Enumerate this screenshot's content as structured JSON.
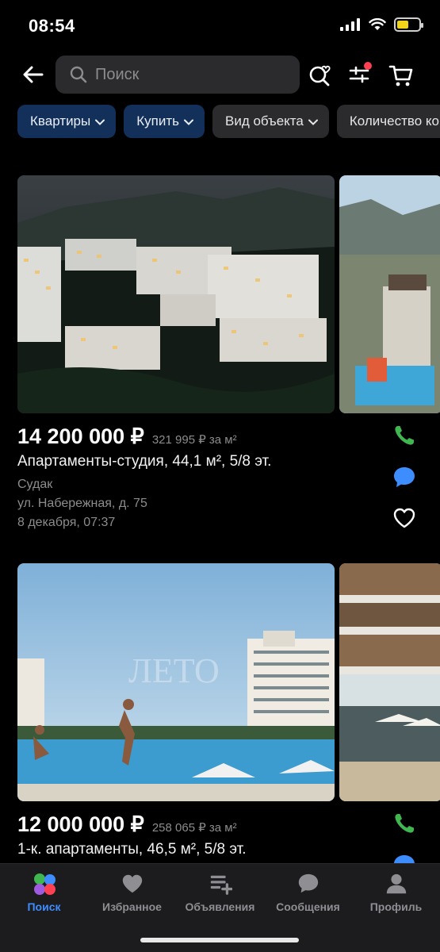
{
  "status": {
    "time": "08:54",
    "battery_level": 0.55
  },
  "search": {
    "placeholder": "Поиск"
  },
  "filters": [
    {
      "label": "Квартиры",
      "style": "blue"
    },
    {
      "label": "Купить",
      "style": "blue"
    },
    {
      "label": "Вид объекта",
      "style": "gray"
    },
    {
      "label": "Количество ко",
      "style": "gray"
    }
  ],
  "listings": [
    {
      "price": "14 200 000 ₽",
      "price_per_m2": "321 995 ₽ за м²",
      "title": "Апартаменты-студия, 44,1 м², 5/8 эт.",
      "city": "Судак",
      "address": "ул. Набережная, д. 75",
      "date": "8 декабря, 07:37"
    },
    {
      "price": "12 000 000 ₽",
      "price_per_m2": "258 065 ₽ за м²",
      "title": "1-к. апартаменты, 46,5 м², 5/8 эт."
    }
  ],
  "watermark": "ЛЕТО",
  "tabs": [
    {
      "label": "Поиск",
      "icon": "search-tab-icon",
      "active": true
    },
    {
      "label": "Избранное",
      "icon": "heart-tab-icon",
      "active": false
    },
    {
      "label": "Объявления",
      "icon": "ads-tab-icon",
      "active": false
    },
    {
      "label": "Сообщения",
      "icon": "chat-tab-icon",
      "active": false
    },
    {
      "label": "Профиль",
      "icon": "profile-tab-icon",
      "active": false
    }
  ],
  "colors": {
    "accent_blue": "#3d8dff",
    "chip_blue": "#13305a",
    "phone_green": "#3fb64f",
    "chat_blue": "#3d8dff",
    "battery_yellow": "#f3d21a",
    "notification_red": "#ff4053"
  }
}
